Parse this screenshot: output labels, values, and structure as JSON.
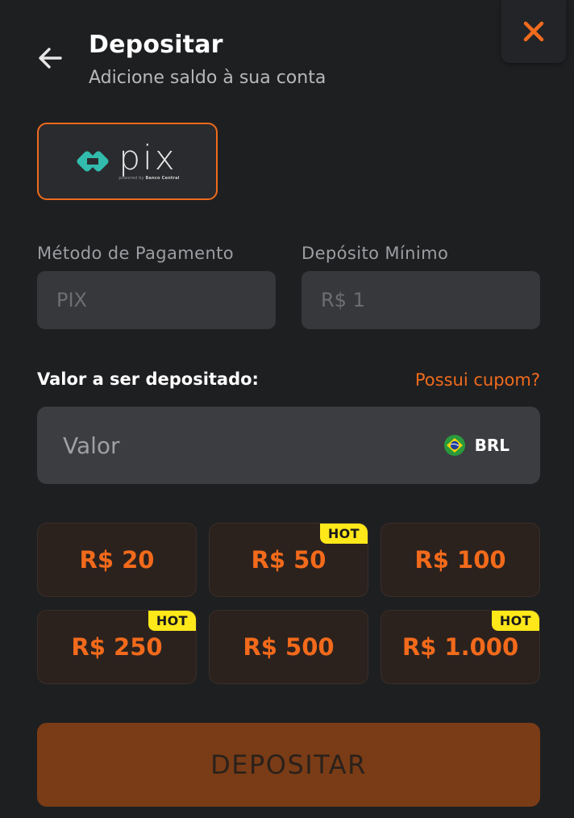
{
  "header": {
    "title": "Depositar",
    "subtitle": "Adicione saldo à sua conta"
  },
  "payment_method_card": {
    "logo_text": "pix",
    "logo_subtext_prefix": "powered by",
    "logo_subtext_bold": "Banco Central"
  },
  "fields": {
    "method_label": "Método de Pagamento",
    "method_value": "PIX",
    "min_label": "Depósito Mínimo",
    "min_value": "R$ 1"
  },
  "amount": {
    "label": "Valor a ser depositado:",
    "coupon_link": "Possui cupom?",
    "placeholder": "Valor",
    "currency": "BRL"
  },
  "presets": [
    {
      "label": "R$ 20",
      "hot": ""
    },
    {
      "label": "R$ 50",
      "hot": "HOT"
    },
    {
      "label": "R$ 100",
      "hot": ""
    },
    {
      "label": "R$ 250",
      "hot": "HOT"
    },
    {
      "label": "R$ 500",
      "hot": ""
    },
    {
      "label": "R$ 1.000",
      "hot": "HOT"
    }
  ],
  "deposit_button": "DEPOSITAR",
  "colors": {
    "accent": "#f06b1d",
    "hot_badge": "#ffe81a",
    "background": "#1e1f21"
  },
  "icons": {
    "close": "close-icon",
    "back": "arrow-left-icon",
    "pix": "pix-logo-icon",
    "flag": "brazil-flag-icon"
  }
}
